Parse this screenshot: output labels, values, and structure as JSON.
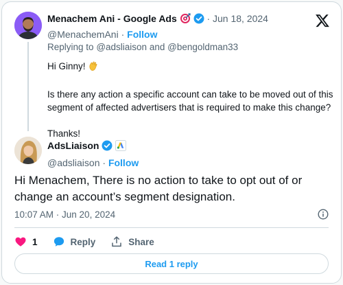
{
  "parent_tweet": {
    "display_name": "Menachem Ani - Google Ads",
    "handle": "@MenachemAni",
    "date": "Jun 18, 2024",
    "follow_label": "Follow",
    "replying_prefix": "Replying to",
    "replying_user1": "@adsliaison",
    "replying_and": "and",
    "replying_user2": "@bengoldman33",
    "greeting": "Hi Ginny!",
    "question": "Is there any action a specific account can take to be moved out of this segment of affected advertisers that is required to make this change?",
    "closing": "Thanks!",
    "icons": [
      "target-emoji-icon",
      "verified-badge-icon",
      "waving-hand-icon"
    ]
  },
  "main_tweet": {
    "display_name": "AdsLiaison",
    "handle": "@adsliaison",
    "follow_label": "Follow",
    "text": "Hi Menachem, There is no action to take to opt out of or change an account’s segment designation.",
    "timestamp": "10:07 AM · Jun 20, 2024",
    "icons": [
      "verified-badge-icon",
      "google-ads-affiliate-icon"
    ]
  },
  "actions": {
    "like_count": "1",
    "reply_label": "Reply",
    "share_label": "Share"
  },
  "read_replies_label": "Read 1 reply",
  "separator": "·",
  "colors": {
    "accent": "#1d9bf0",
    "like": "#f91880",
    "text": "#0f1419",
    "secondary": "#536471",
    "border": "#cfd9de"
  }
}
